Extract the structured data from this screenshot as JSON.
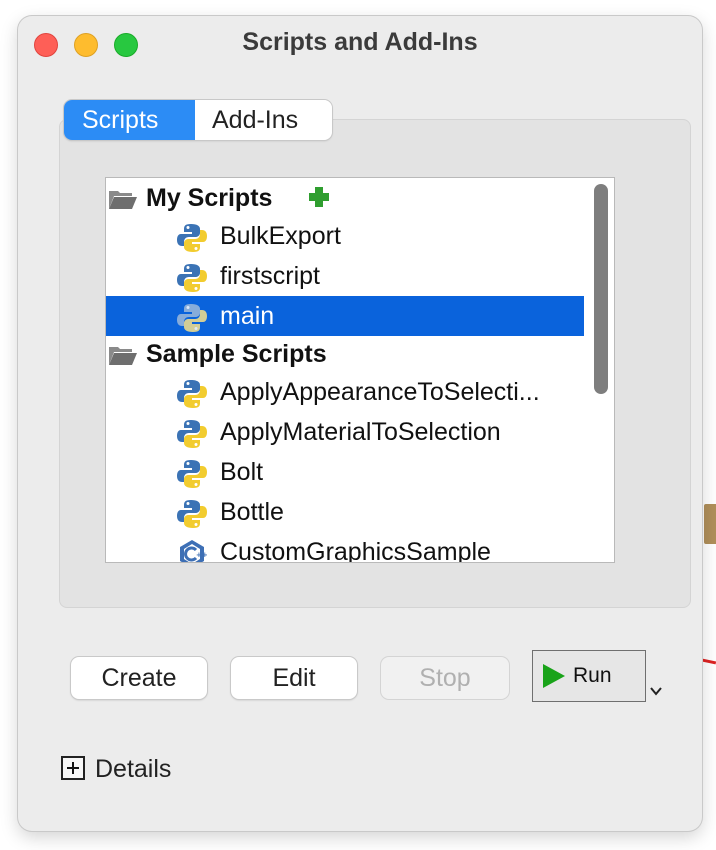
{
  "window": {
    "title": "Scripts and Add-Ins"
  },
  "tabs": [
    {
      "label": "Scripts",
      "active": true
    },
    {
      "label": "Add-Ins",
      "active": false
    }
  ],
  "tree": {
    "groups": [
      {
        "label": "My Scripts",
        "icon": "folder-icon",
        "items": [
          {
            "label": "BulkExport",
            "icon": "python-icon"
          },
          {
            "label": "firstscript",
            "icon": "python-icon"
          },
          {
            "label": "main",
            "icon": "python-icon",
            "selected": true
          }
        ]
      },
      {
        "label": "Sample Scripts",
        "icon": "folder-icon",
        "items": [
          {
            "label": "ApplyAppearanceToSelecti...",
            "icon": "python-icon"
          },
          {
            "label": "ApplyMaterialToSelection",
            "icon": "python-icon"
          },
          {
            "label": "Bolt",
            "icon": "python-icon"
          },
          {
            "label": "Bottle",
            "icon": "python-icon"
          },
          {
            "label": "CustomGraphicsSample",
            "icon": "cpp-icon"
          }
        ]
      }
    ]
  },
  "buttons": {
    "create": "Create",
    "edit": "Edit",
    "stop": "Stop",
    "run": "Run"
  },
  "details": {
    "label": "Details"
  },
  "colors": {
    "accent": "#2c8cf5",
    "selection": "#0a63dc",
    "add_icon": "#2f9e2f",
    "run_icon": "#19a319"
  }
}
